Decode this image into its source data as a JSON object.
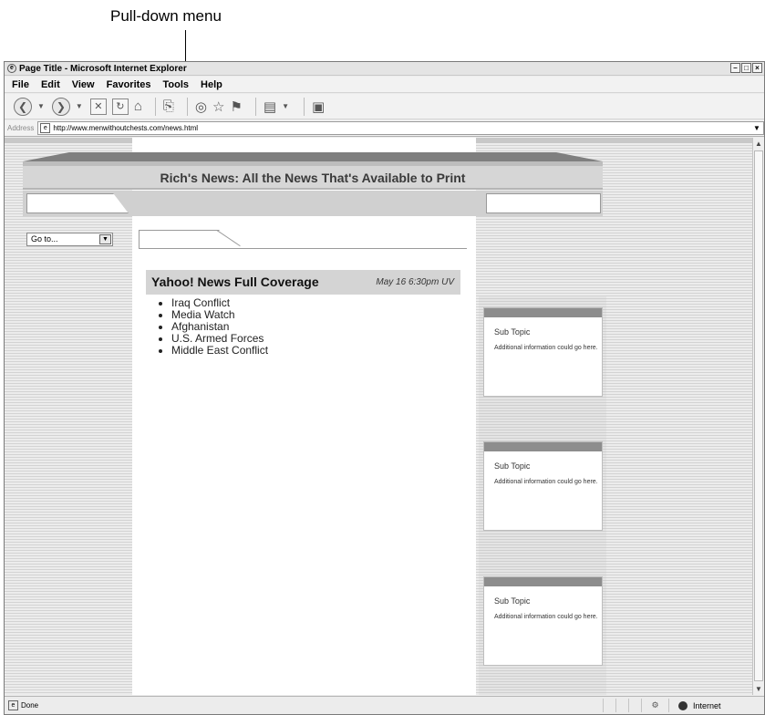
{
  "callout": {
    "label": "Pull-down menu"
  },
  "window": {
    "title": "Page Title - Microsoft Internet Explorer",
    "menu": [
      "File",
      "Edit",
      "View",
      "Favorites",
      "Tools",
      "Help"
    ],
    "address_label": "Address",
    "url": "http://www.menwithoutchests.com/news.html",
    "status_text": "Done",
    "status_zone": "Internet"
  },
  "page": {
    "site_title": "Rich's News: All the News That's Available to Print",
    "goto_select": {
      "selected": "Go to..."
    },
    "news": {
      "title": "Yahoo! News Full Coverage",
      "date": "May 16 6:30pm UV",
      "items": [
        "Iraq Conflict",
        "Media Watch",
        "Afghanistan",
        "U.S. Armed Forces",
        "Middle East Conflict"
      ]
    },
    "cards": [
      {
        "title": "Sub Topic",
        "text": "Additional information could go here."
      },
      {
        "title": "Sub Topic",
        "text": "Additional information could go here."
      },
      {
        "title": "Sub Topic",
        "text": "Additional information could go here."
      }
    ]
  },
  "icons": [
    "back-icon",
    "forward-icon",
    "stop-icon",
    "refresh-icon",
    "home-icon",
    "search-icon",
    "favorites-icon",
    "media-icon",
    "history-icon",
    "mail-icon",
    "messenger-icon",
    "page-icon",
    "globe-icon"
  ]
}
